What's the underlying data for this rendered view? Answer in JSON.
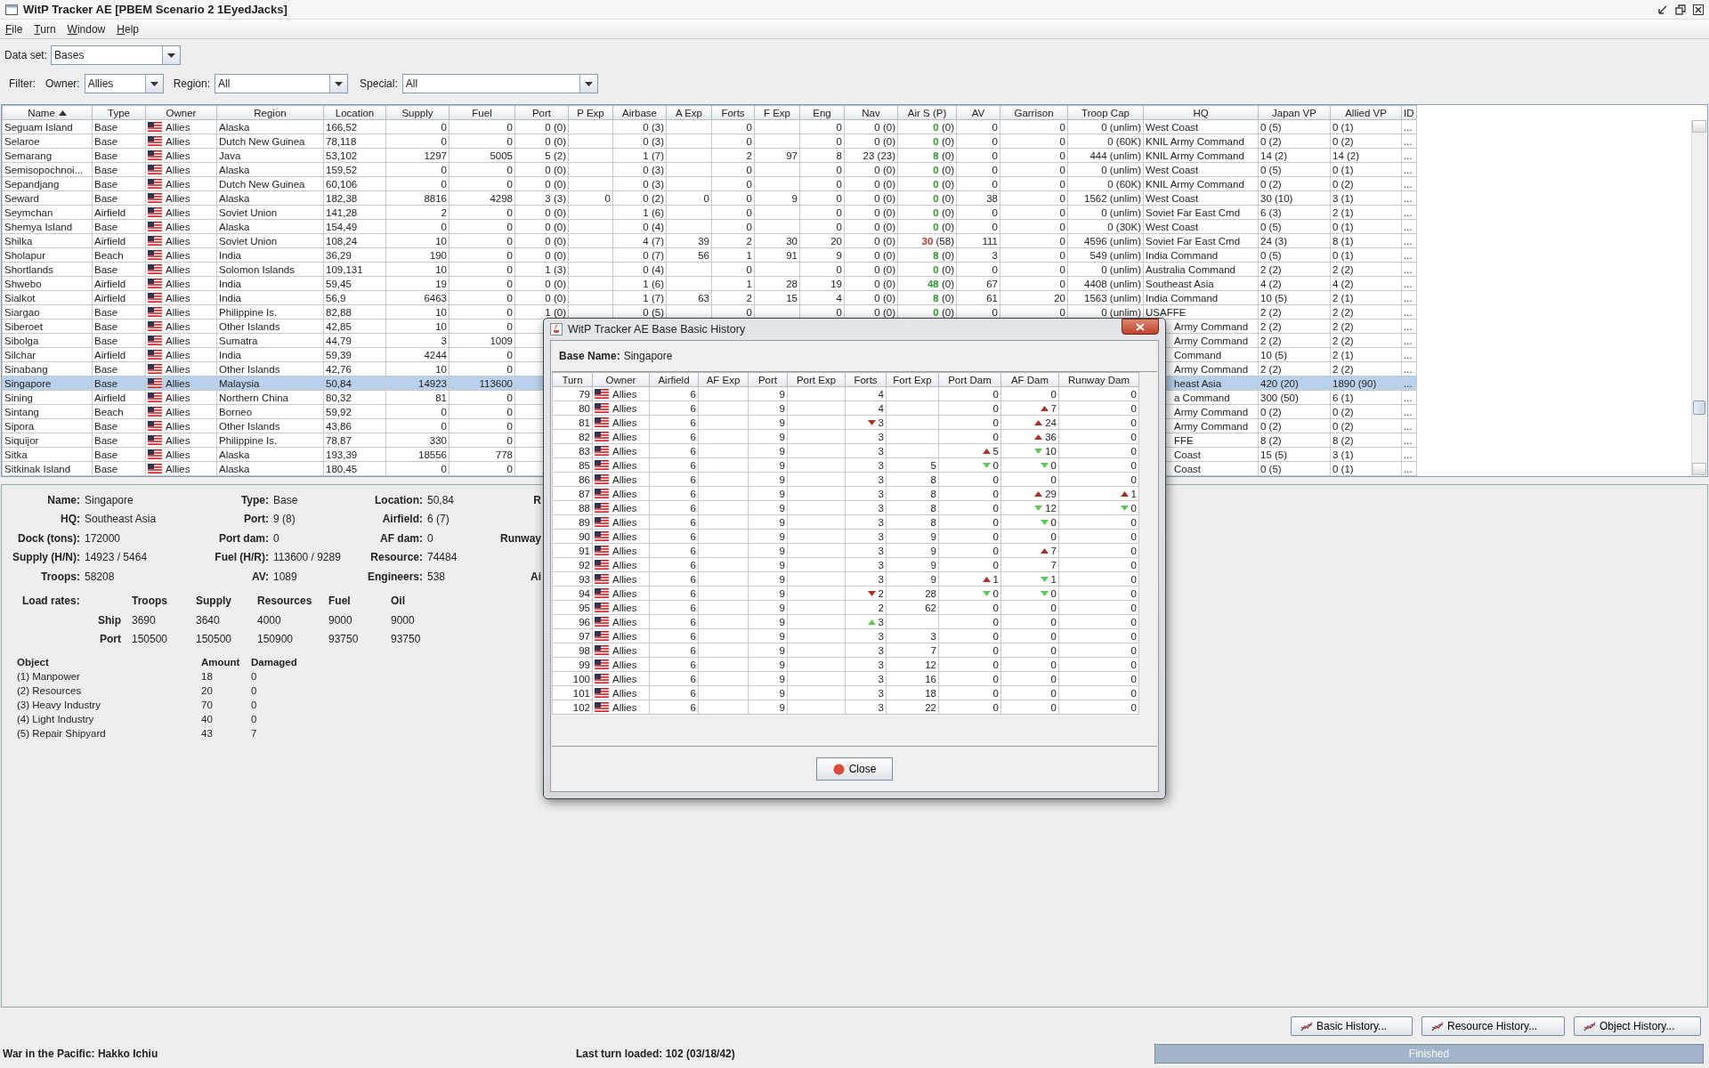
{
  "window": {
    "title": "WitP Tracker AE [PBEM Scenario 2 1EyedJacks]"
  },
  "menu": [
    "File",
    "Turn",
    "Window",
    "Help"
  ],
  "data_set": {
    "label": "Data set:",
    "value": "Bases"
  },
  "filter": {
    "label": "Filter:",
    "fields": [
      {
        "label": "Owner:",
        "value": "Allies"
      },
      {
        "label": "Region:",
        "value": "All"
      },
      {
        "label": "Special:",
        "value": "All"
      }
    ]
  },
  "main_table": {
    "columns": [
      {
        "label": "Name",
        "sorted": true
      },
      {
        "label": "Type",
        "sorted": false
      },
      {
        "label": "Owner",
        "sorted": false
      },
      {
        "label": "Region",
        "sorted": false
      },
      {
        "label": "Location",
        "sorted": false
      },
      {
        "label": "Supply",
        "sorted": false
      },
      {
        "label": "Fuel",
        "sorted": false
      },
      {
        "label": "Port",
        "sorted": false
      },
      {
        "label": "P Exp",
        "sorted": false
      },
      {
        "label": "Airbase",
        "sorted": false
      },
      {
        "label": "A Exp",
        "sorted": false
      },
      {
        "label": "Forts",
        "sorted": false
      },
      {
        "label": "F Exp",
        "sorted": false
      },
      {
        "label": "Eng",
        "sorted": false
      },
      {
        "label": "Nav",
        "sorted": false
      },
      {
        "label": "Air S (P)",
        "sorted": false
      },
      {
        "label": "AV",
        "sorted": false
      },
      {
        "label": "Garrison",
        "sorted": false
      },
      {
        "label": "Troop Cap",
        "sorted": false
      },
      {
        "label": "HQ",
        "sorted": false
      },
      {
        "label": "Japan VP",
        "sorted": false
      },
      {
        "label": "Allied VP",
        "sorted": false
      },
      {
        "label": "ID",
        "sorted": false
      }
    ],
    "rows": [
      {
        "selected": false,
        "cells": [
          "Seguam Island",
          "Base",
          "Allies",
          "Alaska",
          "166,52",
          "0",
          "0",
          "0 (0)",
          null,
          "0 (3)",
          null,
          "0",
          null,
          "0",
          "0 (0)",
          {
            "value": "0",
            "rest": "(0)",
            "color": "#2e9a2e"
          },
          "0",
          "0",
          "0 (unlim)",
          "West Coast",
          "0 (5)",
          "0 (1)",
          "..."
        ]
      },
      {
        "selected": false,
        "cells": [
          "Selaroe",
          "Base",
          "Allies",
          "Dutch New Guinea",
          "78,118",
          "0",
          "0",
          "0 (0)",
          null,
          "0 (3)",
          null,
          "0",
          null,
          "0",
          "0 (0)",
          {
            "value": "0",
            "rest": "(0)",
            "color": "#2e9a2e"
          },
          "0",
          "0",
          "0 (60K)",
          "KNIL Army Command",
          "0 (2)",
          "0 (2)",
          "..."
        ]
      },
      {
        "selected": false,
        "cells": [
          "Semarang",
          "Base",
          "Allies",
          "Java",
          "53,102",
          "1297",
          "5005",
          "5 (2)",
          null,
          "1 (7)",
          null,
          "2",
          "97",
          "8",
          "23 (23)",
          {
            "value": "8",
            "rest": "(0)",
            "color": "#2e9a2e"
          },
          "0",
          "0",
          "444 (unlim)",
          "KNIL Army Command",
          "14 (2)",
          "14 (2)",
          "..."
        ]
      },
      {
        "selected": false,
        "cells": [
          "Semisopochnoi...",
          "Base",
          "Allies",
          "Alaska",
          "159,52",
          "0",
          "0",
          "0 (0)",
          null,
          "0 (3)",
          null,
          "0",
          null,
          "0",
          "0 (0)",
          {
            "value": "0",
            "rest": "(0)",
            "color": "#2e9a2e"
          },
          "0",
          "0",
          "0 (unlim)",
          "West Coast",
          "0 (5)",
          "0 (1)",
          "..."
        ]
      },
      {
        "selected": false,
        "cells": [
          "Sepandjang",
          "Base",
          "Allies",
          "Dutch New Guinea",
          "60,106",
          "0",
          "0",
          "0 (0)",
          null,
          "0 (3)",
          null,
          "0",
          null,
          "0",
          "0 (0)",
          {
            "value": "0",
            "rest": "(0)",
            "color": "#2e9a2e"
          },
          "0",
          "0",
          "0 (60K)",
          "KNIL Army Command",
          "0 (2)",
          "0 (2)",
          "..."
        ]
      },
      {
        "selected": false,
        "cells": [
          "Seward",
          "Base",
          "Allies",
          "Alaska",
          "182,38",
          "8816",
          "4298",
          "3 (3)",
          "0",
          "0 (2)",
          "0",
          "0",
          "9",
          "0",
          "0 (0)",
          {
            "value": "0",
            "rest": "(0)",
            "color": "#2e9a2e"
          },
          "38",
          "0",
          "1562 (unlim)",
          "West Coast",
          "30 (10)",
          "3 (1)",
          "..."
        ]
      },
      {
        "selected": false,
        "cells": [
          "Seymchan",
          "Airfield",
          "Allies",
          "Soviet Union",
          "141,28",
          "2",
          "0",
          "0 (0)",
          null,
          "1 (6)",
          null,
          "0",
          null,
          "0",
          "0 (0)",
          {
            "value": "0",
            "rest": "(0)",
            "color": "#2e9a2e"
          },
          "0",
          "0",
          "0 (unlim)",
          "Soviet Far East Cmd",
          "6 (3)",
          "2 (1)",
          "..."
        ]
      },
      {
        "selected": false,
        "cells": [
          "Shemya Island",
          "Base",
          "Allies",
          "Alaska",
          "154,49",
          "0",
          "0",
          "0 (0)",
          null,
          "0 (4)",
          null,
          "0",
          null,
          "0",
          "0 (0)",
          {
            "value": "0",
            "rest": "(0)",
            "color": "#2e9a2e"
          },
          "0",
          "0",
          "0 (30K)",
          "West Coast",
          "0 (5)",
          "0 (1)",
          "..."
        ]
      },
      {
        "selected": false,
        "cells": [
          "Shilka",
          "Airfield",
          "Allies",
          "Soviet Union",
          "108,24",
          "10",
          "0",
          "0 (0)",
          null,
          "4 (7)",
          "39",
          "2",
          "30",
          "20",
          "0 (0)",
          {
            "value": "30",
            "rest": "(58)",
            "color": "#b03a2e"
          },
          "111",
          "0",
          "4596 (unlim)",
          "Soviet Far East Cmd",
          "24 (3)",
          "8 (1)",
          "..."
        ]
      },
      {
        "selected": false,
        "cells": [
          "Sholapur",
          "Beach",
          "Allies",
          "India",
          "36,29",
          "190",
          "0",
          "0 (0)",
          null,
          "0 (7)",
          "56",
          "1",
          "91",
          "9",
          "0 (0)",
          {
            "value": "8",
            "rest": "(0)",
            "color": "#2e9a2e"
          },
          "3",
          "0",
          "549 (unlim)",
          "India Command",
          "0 (5)",
          "0 (1)",
          "..."
        ]
      },
      {
        "selected": false,
        "cells": [
          "Shortlands",
          "Base",
          "Allies",
          "Solomon Islands",
          "109,131",
          "10",
          "0",
          "1 (3)",
          null,
          "0 (4)",
          null,
          "0",
          null,
          "0",
          "0 (0)",
          {
            "value": "0",
            "rest": "(0)",
            "color": "#2e9a2e"
          },
          "0",
          "0",
          "0 (unlim)",
          "Australia Command",
          "2 (2)",
          "2 (2)",
          "..."
        ]
      },
      {
        "selected": false,
        "cells": [
          "Shwebo",
          "Airfield",
          "Allies",
          "India",
          "59,45",
          "19",
          "0",
          "0 (0)",
          null,
          "1 (6)",
          null,
          "1",
          "28",
          "19",
          "0 (0)",
          {
            "value": "48",
            "rest": "(0)",
            "color": "#2e9a2e"
          },
          "67",
          "0",
          "4408 (unlim)",
          "Southeast Asia",
          "4 (2)",
          "4 (2)",
          "..."
        ]
      },
      {
        "selected": false,
        "cells": [
          "Sialkot",
          "Airfield",
          "Allies",
          "India",
          "56,9",
          "6463",
          "0",
          "0 (0)",
          null,
          "1 (7)",
          "63",
          "2",
          "15",
          "4",
          "0 (0)",
          {
            "value": "8",
            "rest": "(0)",
            "color": "#2e9a2e"
          },
          "61",
          "20",
          "1563 (unlim)",
          "India Command",
          "10 (5)",
          "2 (1)",
          "..."
        ]
      },
      {
        "selected": false,
        "cells": [
          "Siargao",
          "Base",
          "Allies",
          "Philippine Is.",
          "82,88",
          "10",
          "0",
          "1 (0)",
          null,
          "0 (5)",
          null,
          "0",
          null,
          "0",
          "0 (0)",
          {
            "value": "0",
            "rest": "(0)",
            "color": "#2e9a2e"
          },
          "0",
          "0",
          "0 (unlim)",
          "USAFFE",
          "2 (2)",
          "2 (2)",
          "..."
        ]
      },
      {
        "selected": false,
        "cells": [
          "Siberoet",
          "Base",
          "Allies",
          "Other Islands",
          "42,85",
          "10",
          "0",
          null,
          null,
          null,
          null,
          null,
          null,
          null,
          null,
          null,
          null,
          null,
          null,
          "Army Command",
          "2 (2)",
          "2 (2)",
          "..."
        ]
      },
      {
        "selected": false,
        "cells": [
          "Sibolga",
          "Base",
          "Allies",
          "Sumatra",
          "44,79",
          "3",
          "1009",
          null,
          null,
          null,
          null,
          null,
          null,
          null,
          null,
          null,
          null,
          null,
          null,
          "Army Command",
          "2 (2)",
          "2 (2)",
          "..."
        ]
      },
      {
        "selected": false,
        "cells": [
          "Silchar",
          "Airfield",
          "Allies",
          "India",
          "59,39",
          "4244",
          "0",
          null,
          null,
          null,
          null,
          null,
          null,
          null,
          null,
          null,
          null,
          null,
          null,
          "Command",
          "10 (5)",
          "2 (1)",
          "..."
        ]
      },
      {
        "selected": false,
        "cells": [
          "Sinabang",
          "Base",
          "Allies",
          "Other Islands",
          "42,76",
          "10",
          "0",
          null,
          null,
          null,
          null,
          null,
          null,
          null,
          null,
          null,
          null,
          null,
          null,
          "Army Command",
          "2 (2)",
          "2 (2)",
          "..."
        ]
      },
      {
        "selected": true,
        "cells": [
          "Singapore",
          "Base",
          "Allies",
          "Malaysia",
          "50,84",
          "14923",
          "113600",
          null,
          null,
          null,
          null,
          null,
          null,
          null,
          null,
          null,
          null,
          null,
          null,
          "heast Asia",
          "420 (20)",
          "1890 (90)",
          "..."
        ]
      },
      {
        "selected": false,
        "cells": [
          "Sining",
          "Airfield",
          "Allies",
          "Northern China",
          "80,32",
          "81",
          "0",
          null,
          null,
          null,
          null,
          null,
          null,
          null,
          null,
          null,
          null,
          null,
          null,
          "a Command",
          "300 (50)",
          "6 (1)",
          "..."
        ]
      },
      {
        "selected": false,
        "cells": [
          "Sintang",
          "Beach",
          "Allies",
          "Borneo",
          "59,92",
          "0",
          "0",
          null,
          null,
          null,
          null,
          null,
          null,
          null,
          null,
          null,
          null,
          null,
          null,
          "Army Command",
          "0 (2)",
          "0 (2)",
          "..."
        ]
      },
      {
        "selected": false,
        "cells": [
          "Sipora",
          "Base",
          "Allies",
          "Other Islands",
          "43,86",
          "0",
          "0",
          null,
          null,
          null,
          null,
          null,
          null,
          null,
          null,
          null,
          null,
          null,
          null,
          "Army Command",
          "0 (2)",
          "0 (2)",
          "..."
        ]
      },
      {
        "selected": false,
        "cells": [
          "Siquijor",
          "Base",
          "Allies",
          "Philippine Is.",
          "78,87",
          "330",
          "0",
          null,
          null,
          null,
          null,
          null,
          null,
          null,
          null,
          null,
          null,
          null,
          null,
          "FFE",
          "8 (2)",
          "8 (2)",
          "..."
        ]
      },
      {
        "selected": false,
        "cells": [
          "Sitka",
          "Base",
          "Allies",
          "Alaska",
          "193,39",
          "18556",
          "778",
          null,
          null,
          null,
          null,
          null,
          null,
          null,
          null,
          null,
          null,
          null,
          null,
          "Coast",
          "15 (5)",
          "3 (1)",
          "..."
        ]
      },
      {
        "selected": false,
        "cells": [
          "Sitkinak Island",
          "Base",
          "Allies",
          "Alaska",
          "180,45",
          "0",
          "0",
          null,
          null,
          null,
          null,
          null,
          null,
          null,
          null,
          null,
          null,
          null,
          null,
          "Coast",
          "0 (5)",
          "0 (1)",
          "..."
        ]
      }
    ]
  },
  "details": {
    "rows": [
      [
        {
          "label": "Name:",
          "value": "Singapore"
        },
        {
          "label": "Type:",
          "value": "Base"
        },
        {
          "label": "Location:",
          "value": "50,84"
        },
        {
          "label": "R"
        }
      ],
      [
        {
          "label": "HQ:",
          "value": "Southeast Asia"
        },
        {
          "label": "Port:",
          "value": "9 (8)"
        },
        {
          "label": "Airfield:",
          "value": "6 (7)"
        }
      ],
      [
        {
          "label": "Dock (tons):",
          "value": "172000"
        },
        {
          "label": "Port dam:",
          "value": "0"
        },
        {
          "label": "AF dam:",
          "value": "0"
        },
        {
          "label": "Runway"
        }
      ],
      [
        {
          "label": "Supply (H/N):",
          "value": "14923 / 5464"
        },
        {
          "label": "Fuel (H/R):",
          "value": "113600 / 9289"
        },
        {
          "label": "Resource:",
          "value": "74484"
        }
      ],
      [
        {
          "label": "Troops:",
          "value": "58208"
        },
        {
          "label": "AV:",
          "value": "1089"
        },
        {
          "label": "Engineers:",
          "value": "538"
        },
        {
          "label": "Ai"
        }
      ]
    ]
  },
  "load_rates": {
    "title": "Load rates:",
    "columns": [
      "Troops",
      "Supply",
      "Resources",
      "Fuel",
      "Oil"
    ],
    "rows": [
      {
        "label": "Ship",
        "values": [
          "3690",
          "3640",
          "4000",
          "9000",
          "9000"
        ]
      },
      {
        "label": "Port",
        "values": [
          "150500",
          "150500",
          "150900",
          "93750",
          "93750"
        ]
      }
    ]
  },
  "objects": {
    "columns": [
      "Object",
      "Amount",
      "Damaged"
    ],
    "rows": [
      [
        "(1) Manpower",
        "18",
        "0"
      ],
      [
        "(2) Resources",
        "20",
        "0"
      ],
      [
        "(3) Heavy Industry",
        "70",
        "0"
      ],
      [
        "(4) Light Industry",
        "40",
        "0"
      ],
      [
        "(5) Repair Shipyard",
        "43",
        "7"
      ]
    ]
  },
  "buttons": [
    "Basic History...",
    "Resource History...",
    "Object History..."
  ],
  "status_bar": {
    "left": "War in the Pacific: Hakko Ichiu",
    "center": "Last turn loaded: 102 (03/18/42)",
    "progress": {
      "text": "Finished",
      "level": 1
    }
  },
  "dialog": {
    "title": "WitP Tracker AE Base Basic History",
    "base_label": "Base Name:",
    "base_value": "Singapore",
    "table": {
      "columns": [
        "Turn",
        "Owner",
        "Airfield",
        "AF Exp",
        "Port",
        "Port Exp",
        "Forts",
        "Fort Exp",
        "Port Dam",
        "AF Dam",
        "Runway Dam"
      ],
      "rows": [
        {
          "cells": [
            "79",
            "Allies",
            "6",
            null,
            "9",
            null,
            "4",
            null,
            "0",
            "0",
            "0"
          ]
        },
        {
          "cells": [
            "80",
            "Allies",
            "6",
            null,
            "9",
            null,
            "4",
            null,
            "0",
            {
              "value": "7",
              "up": true,
              "color": "#a8322a"
            },
            "0"
          ]
        },
        {
          "cells": [
            "81",
            "Allies",
            "6",
            null,
            "9",
            null,
            {
              "value": "3",
              "up": false,
              "color": "#a8322a"
            },
            null,
            "0",
            {
              "value": "24",
              "up": true,
              "color": "#a8322a"
            },
            "0"
          ]
        },
        {
          "cells": [
            "82",
            "Allies",
            "6",
            null,
            "9",
            null,
            "3",
            null,
            "0",
            {
              "value": "36",
              "up": true,
              "color": "#a8322a"
            },
            "0"
          ]
        },
        {
          "cells": [
            "83",
            "Allies",
            "6",
            null,
            "9",
            null,
            "3",
            null,
            {
              "value": "5",
              "up": true,
              "color": "#a8322a"
            },
            {
              "value": "10",
              "up": false,
              "color": "#5cc85c"
            },
            "0"
          ]
        },
        {
          "cells": [
            "85",
            "Allies",
            "6",
            null,
            "9",
            null,
            "3",
            "5",
            {
              "value": "0",
              "up": false,
              "color": "#5cc85c"
            },
            {
              "value": "0",
              "up": false,
              "color": "#5cc85c"
            },
            "0"
          ]
        },
        {
          "cells": [
            "86",
            "Allies",
            "6",
            null,
            "9",
            null,
            "3",
            "8",
            "0",
            "0",
            "0"
          ]
        },
        {
          "cells": [
            "87",
            "Allies",
            "6",
            null,
            "9",
            null,
            "3",
            "8",
            "0",
            {
              "value": "29",
              "up": true,
              "color": "#a8322a"
            },
            {
              "value": "1",
              "up": true,
              "color": "#a8322a"
            }
          ]
        },
        {
          "cells": [
            "88",
            "Allies",
            "6",
            null,
            "9",
            null,
            "3",
            "8",
            "0",
            {
              "value": "12",
              "up": false,
              "color": "#5cc85c"
            },
            {
              "value": "0",
              "up": false,
              "color": "#5cc85c"
            }
          ]
        },
        {
          "cells": [
            "89",
            "Allies",
            "6",
            null,
            "9",
            null,
            "3",
            "8",
            "0",
            {
              "value": "0",
              "up": false,
              "color": "#5cc85c"
            },
            "0"
          ]
        },
        {
          "cells": [
            "90",
            "Allies",
            "6",
            null,
            "9",
            null,
            "3",
            "9",
            "0",
            "0",
            "0"
          ]
        },
        {
          "cells": [
            "91",
            "Allies",
            "6",
            null,
            "9",
            null,
            "3",
            "9",
            "0",
            {
              "value": "7",
              "up": true,
              "color": "#a8322a"
            },
            "0"
          ]
        },
        {
          "cells": [
            "92",
            "Allies",
            "6",
            null,
            "9",
            null,
            "3",
            "9",
            "0",
            "7",
            "0"
          ]
        },
        {
          "cells": [
            "93",
            "Allies",
            "6",
            null,
            "9",
            null,
            "3",
            "9",
            {
              "value": "1",
              "up": true,
              "color": "#a8322a"
            },
            {
              "value": "1",
              "up": false,
              "color": "#5cc85c"
            },
            "0"
          ]
        },
        {
          "cells": [
            "94",
            "Allies",
            "6",
            null,
            "9",
            null,
            {
              "value": "2",
              "up": false,
              "color": "#a8322a"
            },
            "28",
            {
              "value": "0",
              "up": false,
              "color": "#5cc85c"
            },
            {
              "value": "0",
              "up": false,
              "color": "#5cc85c"
            },
            "0"
          ]
        },
        {
          "cells": [
            "95",
            "Allies",
            "6",
            null,
            "9",
            null,
            "2",
            "62",
            "0",
            "0",
            "0"
          ]
        },
        {
          "cells": [
            "96",
            "Allies",
            "6",
            null,
            "9",
            null,
            {
              "value": "3",
              "up": true,
              "color": "#5cc85c"
            },
            null,
            "0",
            "0",
            "0"
          ]
        },
        {
          "cells": [
            "97",
            "Allies",
            "6",
            null,
            "9",
            null,
            "3",
            "3",
            "0",
            "0",
            "0"
          ]
        },
        {
          "cells": [
            "98",
            "Allies",
            "6",
            null,
            "9",
            null,
            "3",
            "7",
            "0",
            "0",
            "0"
          ]
        },
        {
          "cells": [
            "99",
            "Allies",
            "6",
            null,
            "9",
            null,
            "3",
            "12",
            "0",
            "0",
            "0"
          ]
        },
        {
          "cells": [
            "100",
            "Allies",
            "6",
            null,
            "9",
            null,
            "3",
            "16",
            "0",
            "0",
            "0"
          ]
        },
        {
          "cells": [
            "101",
            "Allies",
            "6",
            null,
            "9",
            null,
            "3",
            "18",
            "0",
            "0",
            "0"
          ]
        },
        {
          "cells": [
            "102",
            "Allies",
            "6",
            null,
            "9",
            null,
            "3",
            "22",
            "0",
            "0",
            "0"
          ]
        }
      ]
    },
    "close_button": "Close"
  }
}
